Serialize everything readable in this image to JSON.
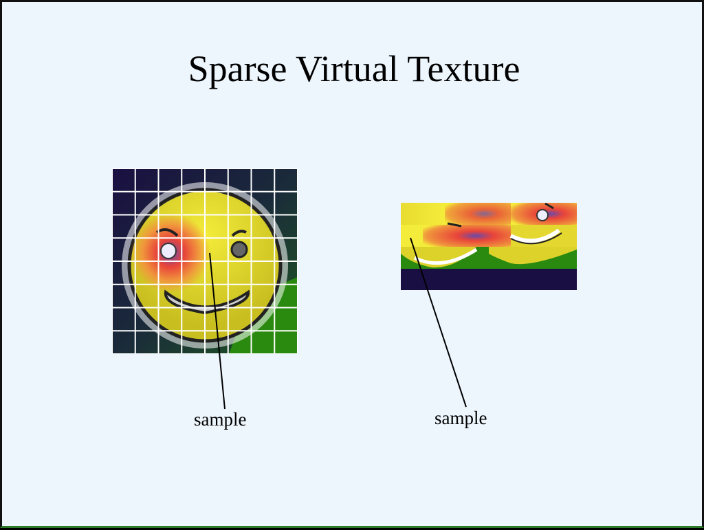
{
  "title": "Sparse Virtual Texture",
  "labels": {
    "virtual_sample": "sample",
    "physical_sample": "sample"
  },
  "colors": {
    "background": "#eef6fd",
    "face": "#dcd22a",
    "face_highlight": "#f4ec3a",
    "heat_red": "#e8443a",
    "heat_orange": "#f0963c",
    "heat_purple": "#6a4aa8",
    "bg_dark": "#1a0f42",
    "bg_green": "#2a8a10",
    "grid": "#ffffff"
  },
  "virtual_texture": {
    "grid_rows": 8,
    "grid_cols": 8
  }
}
